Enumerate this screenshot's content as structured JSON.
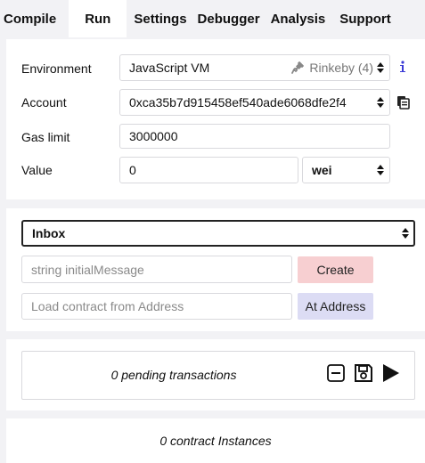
{
  "tabs": [
    {
      "label": "Compile"
    },
    {
      "label": "Run",
      "active": true
    },
    {
      "label": "Settings"
    },
    {
      "label": "Debugger"
    },
    {
      "label": "Analysis"
    },
    {
      "label": "Support"
    }
  ],
  "run": {
    "environment": {
      "label": "Environment",
      "value": "JavaScript VM",
      "network": "Rinkeby (4)"
    },
    "account": {
      "label": "Account",
      "value": "0xca35b7d915458ef540ade6068dfe2f4"
    },
    "gas_limit": {
      "label": "Gas limit",
      "value": "3000000"
    },
    "value": {
      "label": "Value",
      "amount": "0",
      "unit": "wei"
    }
  },
  "contract": {
    "selected": "Inbox",
    "constructor_placeholder": "string initialMessage",
    "create_label": "Create",
    "address_placeholder": "Load contract from Address",
    "at_address_label": "At Address"
  },
  "transactions": {
    "pending_text": "0 pending transactions"
  },
  "instances": {
    "text": "0 contract Instances"
  },
  "colors": {
    "create_button": "#f7cfd1",
    "at_address_button": "#dcdcf4",
    "info_icon": "#3b3bd6"
  }
}
